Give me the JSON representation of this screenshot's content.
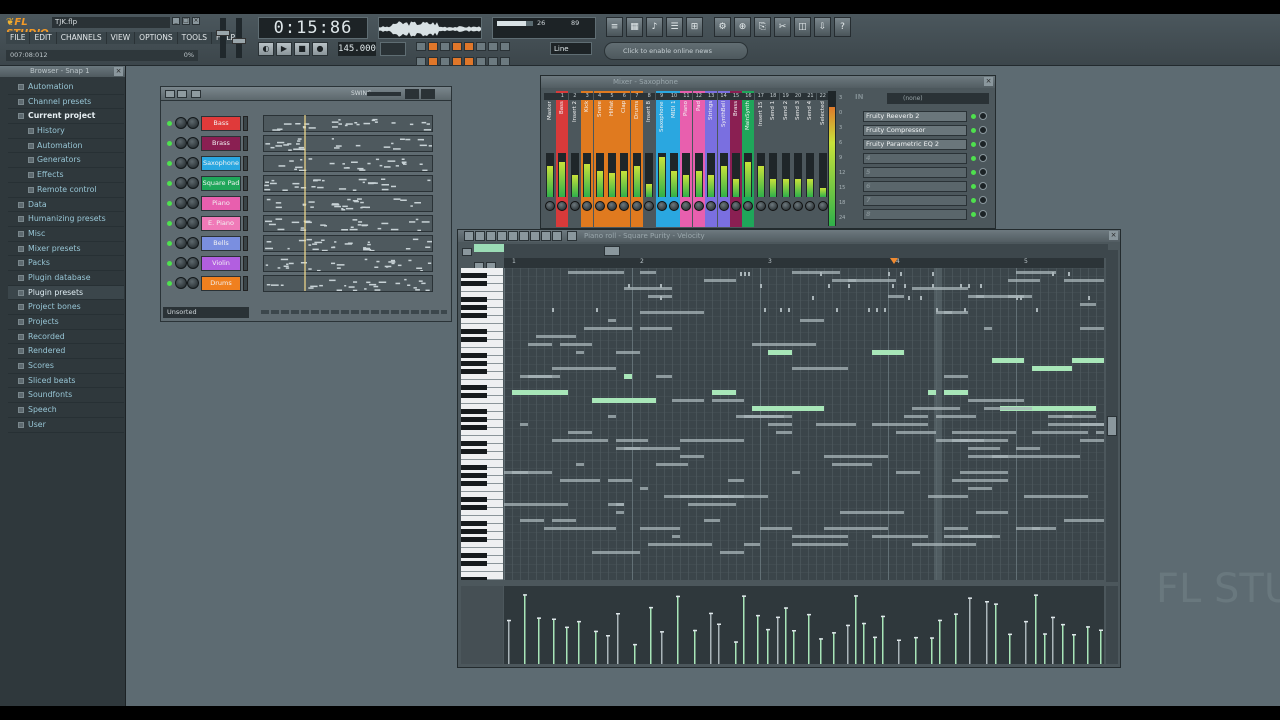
{
  "app": {
    "logo_text": "FL STUDIO",
    "project_name": "TJK.flp",
    "menu": [
      "FILE",
      "EDIT",
      "CHANNELS",
      "VIEW",
      "OPTIONS",
      "TOOLS",
      "HELP"
    ],
    "hint_text": "007:08:012",
    "hint_percent": "0%",
    "time_display": "0:15:86",
    "tempo": "145.000",
    "cpu_value": "26",
    "cpu_poly": "89",
    "cpu_meter_fraction": 0.8,
    "snap_mode": "Line",
    "online_news": "Click to enable online news",
    "accent_color": "#f29a28"
  },
  "browser": {
    "title": "Browser - Snap 1",
    "items": [
      {
        "label": "Automation",
        "level": 0
      },
      {
        "label": "Channel presets",
        "level": 0
      },
      {
        "label": "Current project",
        "level": 0,
        "current": true
      },
      {
        "label": "History",
        "level": 1
      },
      {
        "label": "Automation",
        "level": 1
      },
      {
        "label": "Generators",
        "level": 1
      },
      {
        "label": "Effects",
        "level": 1
      },
      {
        "label": "Remote control",
        "level": 1
      },
      {
        "label": "Data",
        "level": 0
      },
      {
        "label": "Humanizing presets",
        "level": 0
      },
      {
        "label": "Misc",
        "level": 0
      },
      {
        "label": "Mixer presets",
        "level": 0
      },
      {
        "label": "Packs",
        "level": 0
      },
      {
        "label": "Plugin database",
        "level": 0
      },
      {
        "label": "Plugin presets",
        "level": 0,
        "highlight": true
      },
      {
        "label": "Project bones",
        "level": 0
      },
      {
        "label": "Projects",
        "level": 0
      },
      {
        "label": "Recorded",
        "level": 0
      },
      {
        "label": "Rendered",
        "level": 0
      },
      {
        "label": "Scores",
        "level": 0
      },
      {
        "label": "Sliced beats",
        "level": 0
      },
      {
        "label": "Soundfonts",
        "level": 0
      },
      {
        "label": "Speech",
        "level": 0
      },
      {
        "label": "User",
        "level": 0
      }
    ]
  },
  "channel_rack": {
    "swing_label": "SWING",
    "footer_label": "Unsorted",
    "channels": [
      {
        "name": "Bass",
        "color": "#e03a3a"
      },
      {
        "name": "Brass",
        "color": "#8a1f52"
      },
      {
        "name": "Saxophone",
        "color": "#2aa7e0"
      },
      {
        "name": "Square Pad",
        "color": "#1fa65a"
      },
      {
        "name": "Piano",
        "color": "#e85fae"
      },
      {
        "name": "E. Piano",
        "color": "#f07ab8"
      },
      {
        "name": "Bells",
        "color": "#7a8fe0"
      },
      {
        "name": "Violin",
        "color": "#b25fe0"
      },
      {
        "name": "Drums",
        "color": "#f0801f"
      }
    ]
  },
  "mixer": {
    "title": "Mixer - Saxophone",
    "in_label": "IN",
    "in_value": "(none)",
    "tracks": [
      {
        "num": "",
        "label": "Master",
        "color": "#4c575c",
        "level": 0.7
      },
      {
        "num": "1",
        "label": "Bass",
        "color": "#d83a3a",
        "level": 0.8
      },
      {
        "num": "2",
        "label": "Insert 2",
        "color": "#4c575c",
        "level": 0.5
      },
      {
        "num": "3",
        "label": "Kick",
        "color": "#e07a1f",
        "level": 0.75
      },
      {
        "num": "4",
        "label": "Snare",
        "color": "#e07a1f",
        "level": 0.6
      },
      {
        "num": "5",
        "label": "HiHat",
        "color": "#e07a1f",
        "level": 0.55
      },
      {
        "num": "6",
        "label": "Clap",
        "color": "#e07a1f",
        "level": 0.6
      },
      {
        "num": "7",
        "label": "Drums",
        "color": "#e07a1f",
        "level": 0.7
      },
      {
        "num": "8",
        "label": "Insert 8",
        "color": "#4c575c",
        "level": 0.3
      },
      {
        "num": "9",
        "label": "Saxophone",
        "color": "#2aa7e0",
        "level": 0.9
      },
      {
        "num": "10",
        "label": "MIDI 1",
        "color": "#2aa7e0",
        "level": 0.6
      },
      {
        "num": "11",
        "label": "Piano",
        "color": "#e85fae",
        "level": 0.5
      },
      {
        "num": "12",
        "label": "Pad",
        "color": "#e85fae",
        "level": 0.6
      },
      {
        "num": "13",
        "label": "Strings",
        "color": "#7a6fe0",
        "level": 0.5
      },
      {
        "num": "14",
        "label": "SynthBell",
        "color": "#7a6fe0",
        "level": 0.7
      },
      {
        "num": "15",
        "label": "Brass",
        "color": "#8a1f52",
        "level": 0.4
      },
      {
        "num": "16",
        "label": "MainSynth",
        "color": "#1fa65a",
        "level": 0.8
      },
      {
        "num": "17",
        "label": "Insert 15",
        "color": "#4c575c",
        "level": 0.7
      },
      {
        "num": "18",
        "label": "Send 1",
        "color": "#4c575c",
        "level": 0.4
      },
      {
        "num": "19",
        "label": "Send 2",
        "color": "#4c575c",
        "level": 0.4
      },
      {
        "num": "20",
        "label": "Send 3",
        "color": "#4c575c",
        "level": 0.4
      },
      {
        "num": "21",
        "label": "Send 4",
        "color": "#4c575c",
        "level": 0.4
      },
      {
        "num": "22",
        "label": "Selected",
        "color": "#4c575c",
        "level": 0.2
      }
    ],
    "scale": [
      "3",
      "0",
      "3",
      "6",
      "9",
      "12",
      "15",
      "18",
      "24"
    ],
    "fx_slots": [
      {
        "name": "Fruity Reeverb 2",
        "empty": false
      },
      {
        "name": "Fruity Compressor",
        "empty": false
      },
      {
        "name": "Fruity Parametric EQ 2",
        "empty": false
      },
      {
        "name": "4",
        "empty": true
      },
      {
        "name": "5",
        "empty": true
      },
      {
        "name": "6",
        "empty": true
      },
      {
        "name": "7",
        "empty": true
      },
      {
        "name": "8",
        "empty": true
      }
    ]
  },
  "piano_roll": {
    "title": "Piano roll - Square Purity - Velocity",
    "ruler_marks": [
      "1",
      "2",
      "3",
      "4",
      "5"
    ],
    "selected_note_color": "#a8e6b8",
    "note_color": "#aab5b9"
  },
  "watermark": "FL STUDIO"
}
